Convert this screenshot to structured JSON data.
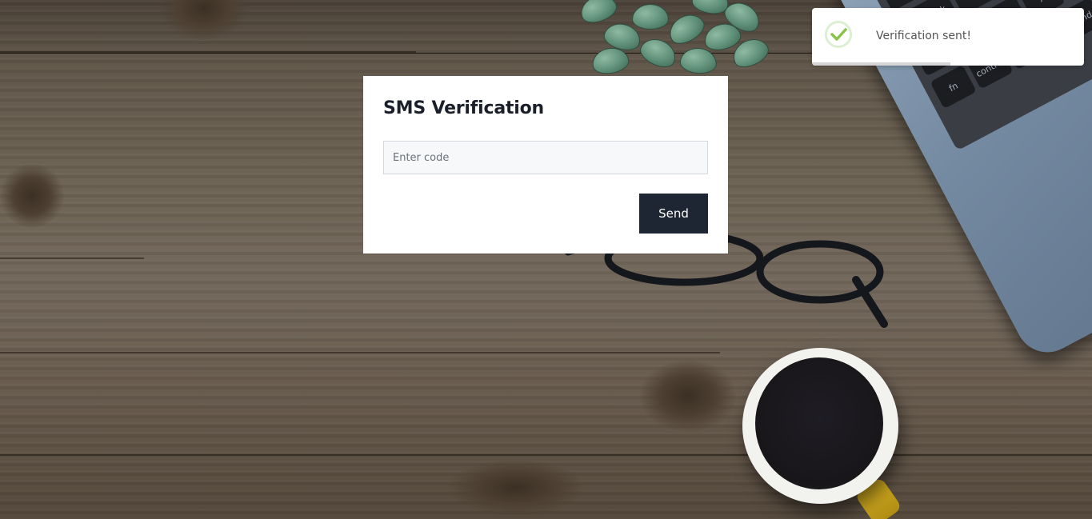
{
  "card": {
    "title": "SMS Verification",
    "code_input": {
      "value": "",
      "placeholder": "Enter code"
    },
    "send_label": "Send"
  },
  "toast": {
    "message": "Verification sent!",
    "icon": "check-circle-icon",
    "progress": 0.51,
    "accent_color": "#8bc34a"
  },
  "colors": {
    "button_background": "#1f2633",
    "card_background": "#ffffff"
  }
}
